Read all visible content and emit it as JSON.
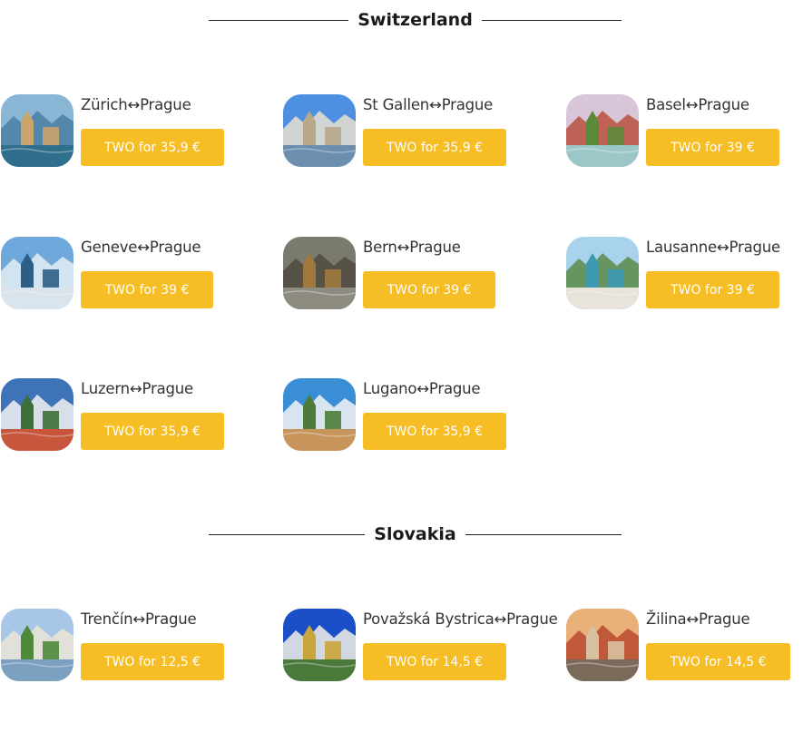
{
  "sections": [
    {
      "title": "Switzerland",
      "cards": [
        {
          "route": "Zürich↔Prague",
          "button": "TWO for 35,9 €",
          "icon": "zurich-photo",
          "colors": [
            "#8ab6d6",
            "#4a7fa5",
            "#c9a46b",
            "#2f6e8c"
          ]
        },
        {
          "route": "St Gallen↔Prague",
          "button": "TWO for 35,9 €",
          "icon": "st-gallen-photo",
          "colors": [
            "#4d8fe0",
            "#e8e0d0",
            "#b8a88a",
            "#6c8fb0"
          ]
        },
        {
          "route": "Basel↔Prague",
          "button": "TWO for 39 €",
          "icon": "basel-photo",
          "colors": [
            "#d8c6d8",
            "#b9503d",
            "#5d8a3a",
            "#9bc7c9"
          ]
        },
        {
          "route": "Geneve↔Prague",
          "button": "TWO for 39 €",
          "icon": "geneve-photo",
          "colors": [
            "#6fa9dc",
            "#e5eef5",
            "#2d5e86",
            "#d9e4ec"
          ]
        },
        {
          "route": "Bern↔Prague",
          "button": "TWO for 39 €",
          "icon": "bern-photo",
          "colors": [
            "#7a7a6e",
            "#4f4a3e",
            "#a0783e",
            "#8e8c80"
          ]
        },
        {
          "route": "Lausanne↔Prague",
          "button": "TWO for 39 €",
          "icon": "lausanne-photo",
          "colors": [
            "#a9d3ec",
            "#5a8a4a",
            "#3d9ab1",
            "#e8e4dc"
          ]
        },
        {
          "route": "Luzern↔Prague",
          "button": "TWO for 35,9 €",
          "icon": "luzern-photo",
          "colors": [
            "#3f73b8",
            "#f2f2f2",
            "#3e6e3a",
            "#c7563c"
          ]
        },
        {
          "route": "Lugano↔Prague",
          "button": "TWO for 35,9 €",
          "icon": "lugano-photo",
          "colors": [
            "#3a8ed6",
            "#f5f5f5",
            "#4d7c39",
            "#c7945c"
          ]
        }
      ]
    },
    {
      "title": "Slovakia",
      "cards": [
        {
          "route": "Trenčín↔Prague",
          "button": "TWO for 12,5 €",
          "icon": "trencin-photo",
          "colors": [
            "#a8c7e8",
            "#ece5d6",
            "#4f8a3a",
            "#7ba0c0"
          ]
        },
        {
          "route": "Považská Bystrica↔Prague",
          "button": "TWO for 14,5 €",
          "icon": "povazska-bystrica-photo",
          "colors": [
            "#1b4fc7",
            "#f2f0e6",
            "#caa53c",
            "#4a7a3a"
          ]
        },
        {
          "route": "Žilina↔Prague",
          "button": "TWO for 14,5 €",
          "icon": "zilina-photo",
          "colors": [
            "#e9b07a",
            "#b74a2e",
            "#d8c0a0",
            "#7a6a5a"
          ]
        }
      ]
    }
  ]
}
